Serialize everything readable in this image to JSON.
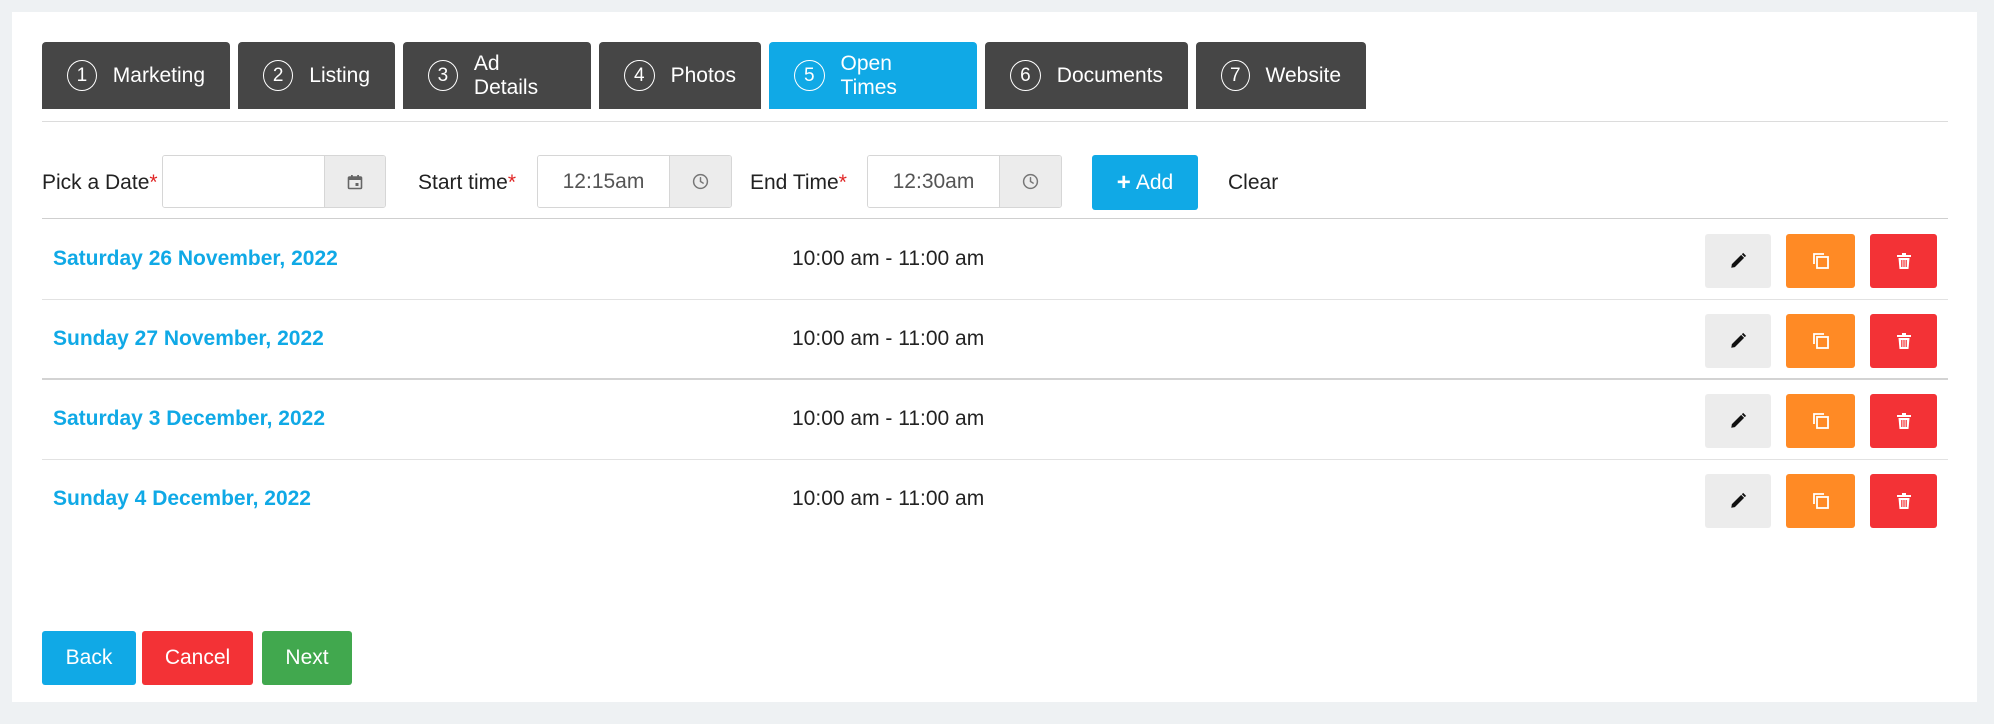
{
  "tabs": [
    {
      "num": "1",
      "label": "Marketing"
    },
    {
      "num": "2",
      "label": "Listing"
    },
    {
      "num": "3",
      "label": "Ad Details"
    },
    {
      "num": "4",
      "label": "Photos"
    },
    {
      "num": "5",
      "label": "Open Times"
    },
    {
      "num": "6",
      "label": "Documents"
    },
    {
      "num": "7",
      "label": "Website"
    }
  ],
  "active_tab": "Open Times",
  "form": {
    "date_label": "Pick a Date",
    "date_value": "",
    "start_label": "Start time",
    "start_value": "12:15am",
    "end_label": "End Time",
    "end_value": "12:30am",
    "required_mark": "*",
    "add_label": "Add",
    "clear_label": "Clear"
  },
  "open_times": [
    {
      "date": "Saturday 26 November, 2022",
      "time": "10:00 am - 11:00 am"
    },
    {
      "date": "Sunday 27 November, 2022",
      "time": "10:00 am - 11:00 am"
    },
    {
      "date": "Saturday 3 December, 2022",
      "time": "10:00 am - 11:00 am"
    },
    {
      "date": "Sunday 4 December, 2022",
      "time": "10:00 am - 11:00 am"
    }
  ],
  "footer": {
    "back_label": "Back",
    "cancel_label": "Cancel",
    "next_label": "Next"
  },
  "colors": {
    "tab_bg": "#464646",
    "active_tab_bg": "#10a9e6",
    "accent_blue": "#10a9e6",
    "edit_bg": "#ececec",
    "copy_orange": "#ff8a25",
    "delete_red": "#f33236",
    "next_green": "#41a84e"
  }
}
